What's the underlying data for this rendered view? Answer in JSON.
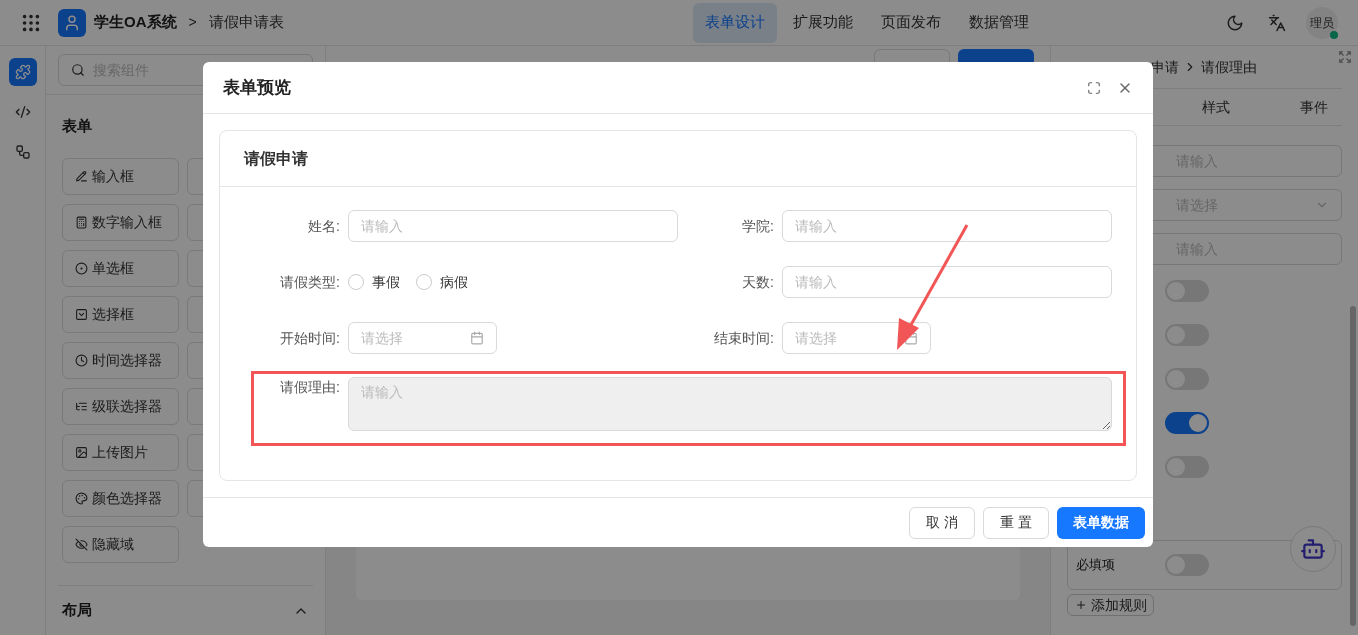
{
  "header": {
    "app_name": "学生OA系统",
    "separator": ">",
    "page_title": "请假申请表",
    "nav": [
      {
        "label": "表单设计",
        "selected": true
      },
      {
        "label": "扩展功能",
        "selected": false
      },
      {
        "label": "页面发布",
        "selected": false
      },
      {
        "label": "数据管理",
        "selected": false
      }
    ],
    "avatar": "理员"
  },
  "rail": [
    {
      "kind": "puzzle",
      "selected": true
    },
    {
      "kind": "code",
      "selected": false
    },
    {
      "kind": "tree",
      "selected": false
    }
  ],
  "components_panel": {
    "search": {
      "placeholder": "搜索组件"
    },
    "section": "表单",
    "items": [
      {
        "label": "输入框",
        "kind": "pen"
      },
      {
        "label": "数字输入框",
        "kind": "number"
      },
      {
        "label": "单选框",
        "kind": "radio"
      },
      {
        "label": "选择框",
        "kind": "select"
      },
      {
        "label": "时间选择器",
        "kind": "clock"
      },
      {
        "label": "级联选择器",
        "kind": "cascade"
      },
      {
        "label": "上传图片",
        "kind": "image"
      },
      {
        "label": "颜色选择器",
        "kind": "palette"
      },
      {
        "label": "隐藏域",
        "kind": "eye-off"
      }
    ],
    "layout_section": "布局"
  },
  "props_panel": {
    "breadcrumb": [
      "申请",
      "请假理由"
    ],
    "tabs": [
      {
        "label": "样式",
        "selected": false
      },
      {
        "label": "事件",
        "selected": false
      }
    ],
    "fields": [
      {
        "placeholder": "请输入",
        "kind": "input"
      },
      {
        "placeholder": "请选择",
        "kind": "select"
      },
      {
        "placeholder": "请输入",
        "kind": "input"
      }
    ],
    "toggles": [
      {
        "on": false
      },
      {
        "on": false
      },
      {
        "on": false
      },
      {
        "on": true
      },
      {
        "on": false
      }
    ],
    "required": {
      "label": "必填项",
      "on": false
    },
    "add_rule": "添加规则"
  },
  "dialog": {
    "title": "表单预览",
    "card_title": "请假申请",
    "fields": [
      {
        "label": "姓名:",
        "kind": "input",
        "placeholder": "请输入"
      },
      {
        "label": "学院:",
        "kind": "input",
        "placeholder": "请输入"
      },
      {
        "label": "请假类型:",
        "kind": "radio",
        "options": [
          {
            "label": "事假",
            "selected": false
          },
          {
            "label": "病假",
            "selected": false
          }
        ]
      },
      {
        "label": "天数:",
        "kind": "input",
        "placeholder": "请输入"
      },
      {
        "label": "开始时间:",
        "kind": "date",
        "placeholder": "请选择"
      },
      {
        "label": "结束时间:",
        "kind": "date",
        "placeholder": "请选择"
      },
      {
        "label": "请假理由:",
        "kind": "textarea",
        "placeholder": "请输入",
        "disabled": true,
        "highlighted": true
      }
    ],
    "buttons": [
      {
        "label": "取 消",
        "kind": "default"
      },
      {
        "label": "重 置",
        "kind": "default"
      },
      {
        "label": "表单数据",
        "kind": "primary"
      }
    ]
  }
}
